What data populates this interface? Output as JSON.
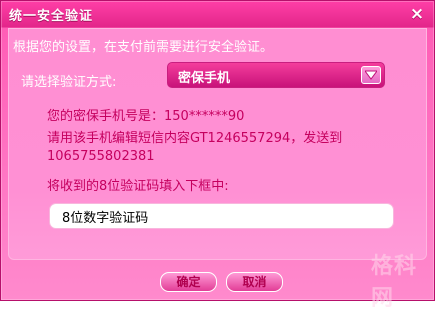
{
  "dialog": {
    "title": "统一安全验证",
    "close_icon": "×"
  },
  "body": {
    "description": "根据您的设置，在支付前需要进行安全验证。",
    "method_label": "请选择验证方式:",
    "method_value": "密保手机",
    "phone_line": "您的密保手机号是：150******90",
    "sms_line": "请用该手机编辑短信内容GT1246557294，发送到",
    "sms_number": "1065755802381",
    "input_instruction": "将收到的8位验证码填入下框中:",
    "code_value": "8位数字验证码"
  },
  "watermark": "格科网",
  "buttons": {
    "confirm": "确定",
    "cancel": "取消"
  },
  "colors": {
    "title_bar": "#e3268a",
    "panel": "#ff90d4",
    "info_text": "#c5005e"
  },
  "icons": {
    "close": "close-icon",
    "dropdown": "chevron-down-icon"
  }
}
